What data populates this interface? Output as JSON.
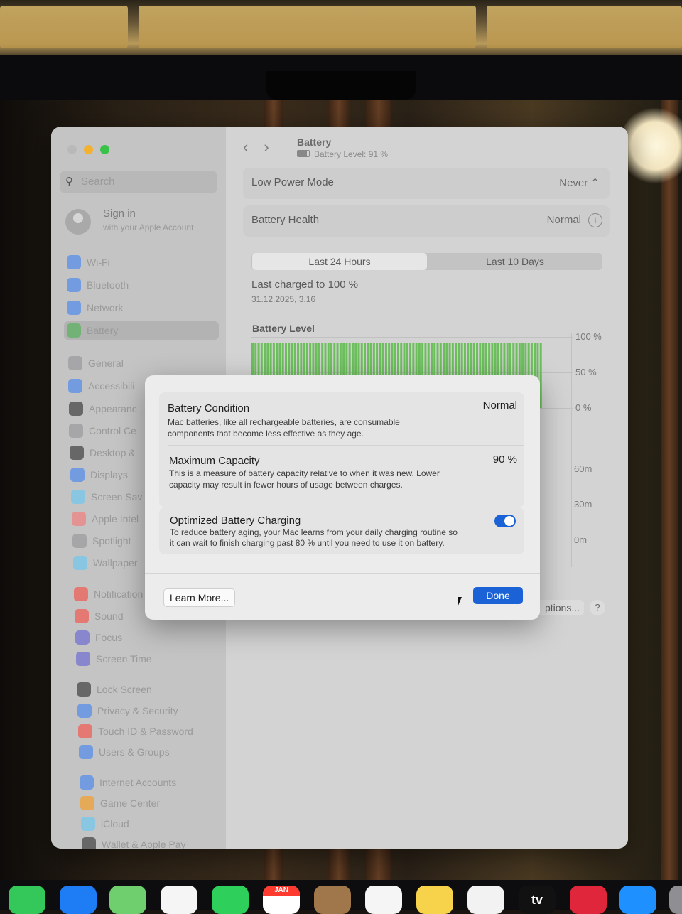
{
  "window": {
    "title": "Battery",
    "subtitle": "Battery Level: 91 %"
  },
  "sidebar": {
    "search_placeholder": "Search",
    "account": {
      "title": "Sign in",
      "subtitle": "with your Apple Account"
    },
    "items": [
      {
        "label": "Wi-Fi",
        "icon": "wifi-icon",
        "color": "#2f7cf6"
      },
      {
        "label": "Bluetooth",
        "icon": "bluetooth-icon",
        "color": "#2f7cf6"
      },
      {
        "label": "Network",
        "icon": "globe-icon",
        "color": "#2f7cf6"
      },
      {
        "label": "Battery",
        "icon": "battery-icon",
        "color": "#3cb043",
        "selected": true
      },
      {
        "label": "General",
        "icon": "gear-icon",
        "color": "#8e8e93"
      },
      {
        "label": "Accessibili",
        "icon": "accessibility-icon",
        "color": "#2f7cf6"
      },
      {
        "label": "Appearanc",
        "icon": "appearance-icon",
        "color": "#1c1c1e"
      },
      {
        "label": "Control Ce",
        "icon": "control-center-icon",
        "color": "#8e8e93"
      },
      {
        "label": "Desktop &",
        "icon": "desktop-icon",
        "color": "#1c1c1e"
      },
      {
        "label": "Displays",
        "icon": "display-icon",
        "color": "#2f7cf6"
      },
      {
        "label": "Screen Sav",
        "icon": "screensaver-icon",
        "color": "#5ac8fa"
      },
      {
        "label": "Apple Intel",
        "icon": "apple-intelligence-icon",
        "color": "#ff6b6b"
      },
      {
        "label": "Spotlight",
        "icon": "spotlight-icon",
        "color": "#8e8e93"
      },
      {
        "label": "Wallpaper",
        "icon": "wallpaper-icon",
        "color": "#5ac8fa"
      },
      {
        "label": "Notification",
        "icon": "notifications-icon",
        "color": "#ff3b30"
      },
      {
        "label": "Sound",
        "icon": "sound-icon",
        "color": "#ff3b30"
      },
      {
        "label": "Focus",
        "icon": "focus-icon",
        "color": "#5856d6"
      },
      {
        "label": "Screen Time",
        "icon": "screen-time-icon",
        "color": "#5856d6"
      },
      {
        "label": "Lock Screen",
        "icon": "lock-icon",
        "color": "#1c1c1e"
      },
      {
        "label": "Privacy & Security",
        "icon": "privacy-icon",
        "color": "#2f7cf6"
      },
      {
        "label": "Touch ID & Password",
        "icon": "touch-id-icon",
        "color": "#ff3b30"
      },
      {
        "label": "Users & Groups",
        "icon": "users-icon",
        "color": "#2f7cf6"
      },
      {
        "label": "Internet Accounts",
        "icon": "at-icon",
        "color": "#2f7cf6"
      },
      {
        "label": "Game Center",
        "icon": "game-center-icon",
        "color": "#ff9500"
      },
      {
        "label": "iCloud",
        "icon": "cloud-icon",
        "color": "#5ac8fa"
      },
      {
        "label": "Wallet & Apple Pay",
        "icon": "wallet-icon",
        "color": "#1c1c1e"
      }
    ]
  },
  "main": {
    "low_power": {
      "label": "Low Power Mode",
      "value": "Never ⌃"
    },
    "health": {
      "label": "Battery Health",
      "value": "Normal"
    },
    "tabs": [
      "Last 24 Hours",
      "Last 10 Days"
    ],
    "last_charged": "Last charged to 100 %",
    "last_charged_date": "31.12.2025, 3.16",
    "chart_title": "Battery Level",
    "battery_ticks": [
      "100 %",
      "50 %",
      "0 %"
    ],
    "usage_ticks": [
      "60m",
      "30m",
      "0m"
    ],
    "options_label": "ptions...",
    "help_label": "?"
  },
  "chart_data": {
    "type": "bar",
    "title": "Battery Level",
    "ylim": [
      0,
      100
    ],
    "yticks": [
      "100 %",
      "50 %",
      "0 %"
    ],
    "bar_color": "#6cbf5c",
    "values": [
      91
    ]
  },
  "modal": {
    "condition": {
      "title": "Battery Condition",
      "value": "Normal",
      "desc1": "Mac batteries, like all rechargeable batteries, are consumable",
      "desc2": "components that become less effective as they age."
    },
    "capacity": {
      "title": "Maximum Capacity",
      "value": "90 %",
      "desc1": "This is a measure of battery capacity relative to when it was new. Lower",
      "desc2": "capacity may result in fewer hours of usage between charges."
    },
    "optimized": {
      "title": "Optimized Battery Charging",
      "enabled": true,
      "desc1": "To reduce battery aging, your Mac learns from your daily charging routine so",
      "desc2": "it can wait to finish charging past 80 % until you need to use it on battery."
    },
    "learn_more": "Learn More...",
    "done": "Done"
  },
  "dock": {
    "calendar_month": "JAN",
    "tv_label": "tv",
    "apps": [
      {
        "name": "messages-icon",
        "color": "#34c759"
      },
      {
        "name": "mail-icon",
        "color": "#1e7cf5"
      },
      {
        "name": "maps-icon",
        "color": "#6fcf6f"
      },
      {
        "name": "photos-icon",
        "color": "#f5f5f5"
      },
      {
        "name": "facetime-icon",
        "color": "#2fcf5c"
      },
      {
        "name": "calendar-icon",
        "color": "#ffffff"
      },
      {
        "name": "contacts-icon",
        "color": "#a0774a"
      },
      {
        "name": "reminders-icon",
        "color": "#f5f5f5"
      },
      {
        "name": "notes-icon",
        "color": "#f7d24b"
      },
      {
        "name": "freeform-icon",
        "color": "#f2f2f2"
      },
      {
        "name": "tv-icon",
        "color": "#111111"
      },
      {
        "name": "music-icon",
        "color": "#e0263a"
      },
      {
        "name": "app-store-icon",
        "color": "#1e90ff"
      },
      {
        "name": "settings-icon",
        "color": "#8e8e93"
      }
    ]
  }
}
